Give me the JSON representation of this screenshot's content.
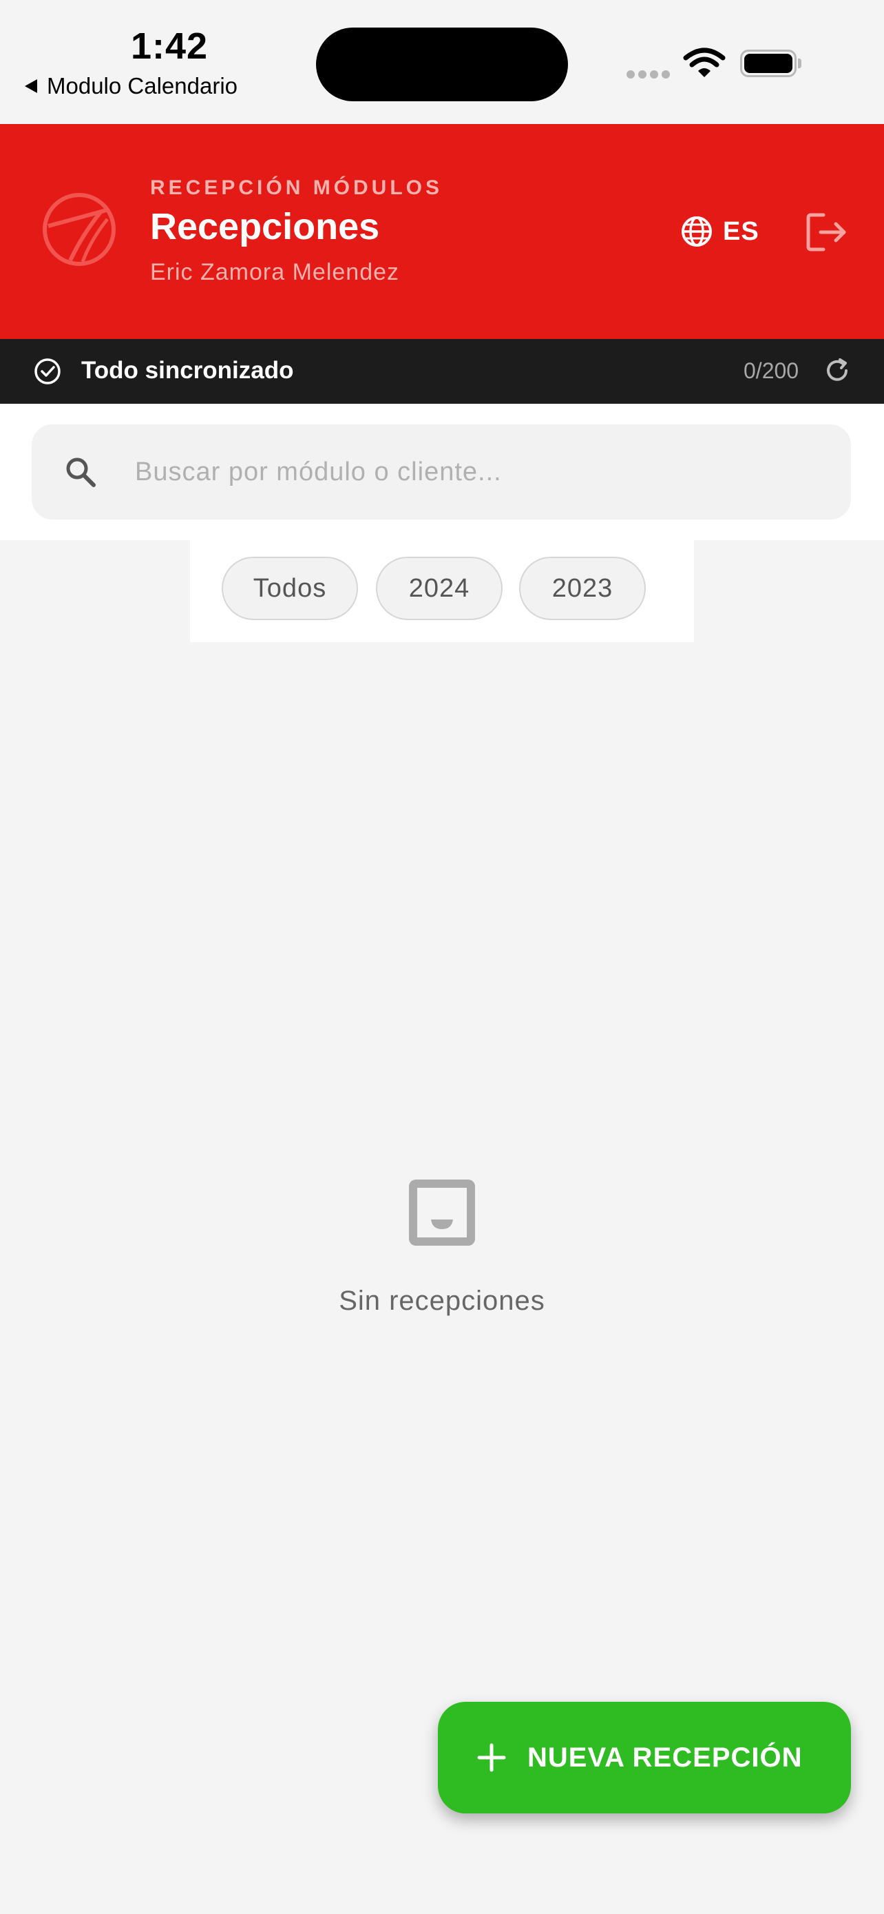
{
  "status_bar": {
    "time": "1:42",
    "back_label": "Modulo Calendario"
  },
  "header": {
    "eyebrow": "RECEPCIÓN MÓDULOS",
    "title": "Recepciones",
    "user": "Eric Zamora Melendez",
    "language": "ES",
    "brand_color": "#e31a16"
  },
  "sync": {
    "status": "Todo sincronizado",
    "count": "0/200"
  },
  "search": {
    "placeholder": "Buscar por módulo o cliente..."
  },
  "filters": {
    "chips": [
      "Todos",
      "2024",
      "2023"
    ]
  },
  "empty_state": {
    "icon": "inbox-icon",
    "message": "Sin recepciones"
  },
  "fab": {
    "label": "NUEVA RECEPCIÓN",
    "color": "#2fbb22"
  }
}
